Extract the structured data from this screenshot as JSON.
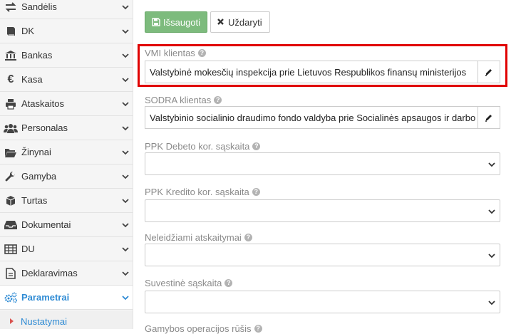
{
  "sidebar": {
    "items": [
      {
        "label": "Sandėlis",
        "icon": "arrows-exchange-icon"
      },
      {
        "label": "DK",
        "icon": "book-icon"
      },
      {
        "label": "Bankas",
        "icon": "bank-icon"
      },
      {
        "label": "Kasa",
        "icon": "euro-icon"
      },
      {
        "label": "Ataskaitos",
        "icon": "printer-icon"
      },
      {
        "label": "Personalas",
        "icon": "users-icon"
      },
      {
        "label": "Žinynai",
        "icon": "folder-open-icon"
      },
      {
        "label": "Gamyba",
        "icon": "wrench-icon"
      },
      {
        "label": "Turtas",
        "icon": "cube-icon"
      },
      {
        "label": "Dokumentai",
        "icon": "inbox-icon"
      },
      {
        "label": "DU",
        "icon": "table-icon"
      },
      {
        "label": "Deklaravimas",
        "icon": "file-text-icon"
      },
      {
        "label": "Parametrai",
        "icon": "cogs-icon",
        "active": true
      }
    ],
    "sub_item": {
      "label": "Nustatymai"
    }
  },
  "toolbar": {
    "save_label": "Išsaugoti",
    "close_label": "Uždaryti"
  },
  "form": {
    "vmi": {
      "label": "VMI klientas",
      "value": "Valstybinė mokesčių inspekcija prie Lietuvos Respublikos finansų ministerijos"
    },
    "sodra": {
      "label": "SODRA klientas",
      "value": "Valstybinio socialinio draudimo fondo valdyba prie Socialinės apsaugos ir darbo ministerijos"
    },
    "ppk_debet": {
      "label": "PPK Debeto kor. sąskaita",
      "value": ""
    },
    "ppk_kredit": {
      "label": "PPK Kredito kor. sąskaita",
      "value": ""
    },
    "neleidziami": {
      "label": "Neleidžiami atskaitymai",
      "value": ""
    },
    "suvestine": {
      "label": "Suvestinė sąskaita",
      "value": ""
    },
    "gamybos": {
      "label": "Gamybos operacijos rūšis"
    }
  },
  "colors": {
    "accent": "#2f8bd4",
    "save_button": "#7dbb7d",
    "highlight": "#e00000"
  }
}
